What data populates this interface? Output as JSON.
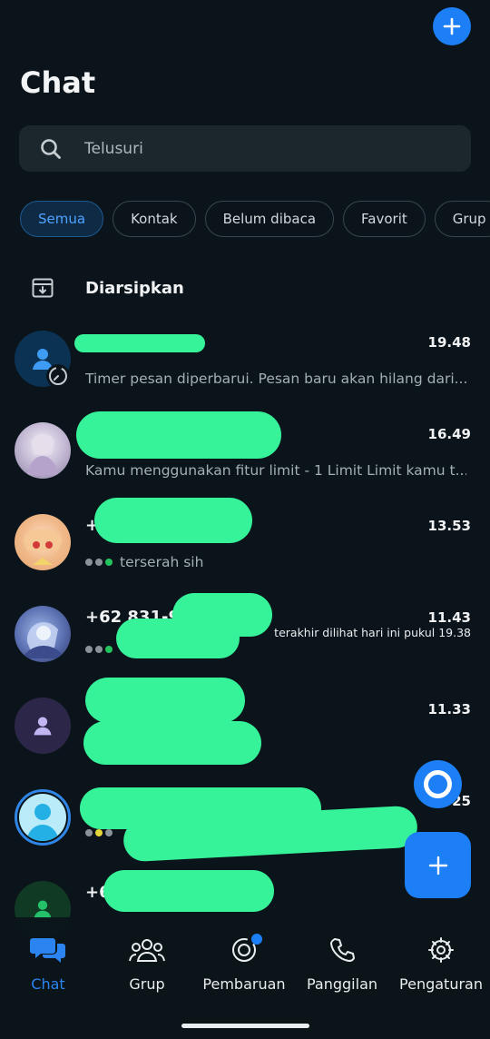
{
  "app": {
    "title": "Chat"
  },
  "search": {
    "placeholder": "Telusuri"
  },
  "filters": [
    "Semua",
    "Kontak",
    "Belum dibaca",
    "Favorit",
    "Grup"
  ],
  "archived": {
    "label": "Diarsipkan"
  },
  "chats": [
    {
      "name": "",
      "time": "19.48",
      "preview": "Timer pesan diperbarui. Pesan baru akan hilang dari...",
      "avatar": "default-person-icon"
    },
    {
      "name": "",
      "time": "16.49",
      "preview": "Kamu menggunakan fitur limit - 1 Limit Limit kamu t...",
      "avatar": "anime-girl-photo"
    },
    {
      "name": "+",
      "time": "13.53",
      "preview": "terserah sih",
      "avatar": "anime-boy-photo"
    },
    {
      "name": "+62 831-9",
      "time": "11.43",
      "last_seen": "terakhir dilihat hari ini pukul 19.38",
      "preview": "",
      "avatar": "anime-blue-photo"
    },
    {
      "name": "",
      "time": "11.33",
      "preview": "",
      "avatar": "default-person-icon"
    },
    {
      "name": "",
      "time": "25",
      "preview": "",
      "avatar": "default-person-icon"
    },
    {
      "name": "+6",
      "time": "",
      "preview": "",
      "avatar": "default-person-icon"
    }
  ],
  "nav": [
    {
      "label": "Chat",
      "icon": "chat-bubbles-icon",
      "active": true
    },
    {
      "label": "Grup",
      "icon": "group-icon",
      "active": false
    },
    {
      "label": "Pembaruan",
      "icon": "updates-icon",
      "active": false
    },
    {
      "label": "Panggilan",
      "icon": "phone-icon",
      "active": false
    },
    {
      "label": "Pengaturan",
      "icon": "gear-icon",
      "active": false
    }
  ],
  "colors": {
    "accent": "#1d7ff5",
    "background": "#0b141a",
    "redaction": "#36f39a"
  }
}
